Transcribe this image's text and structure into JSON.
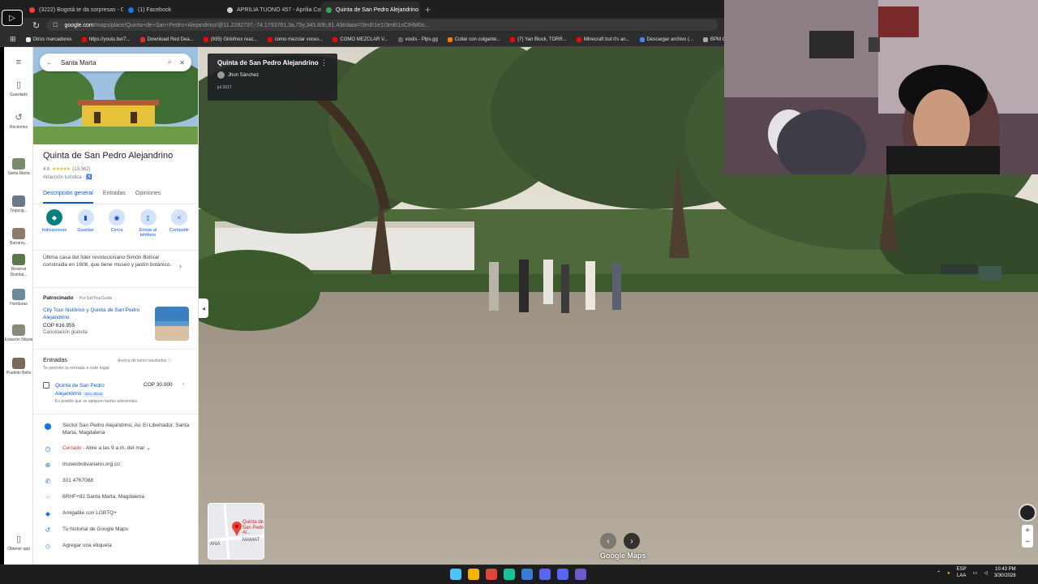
{
  "browser": {
    "tabs": [
      {
        "label": "(3222) Bogotá te da sorpresas - Obv...",
        "color": "#ff3b30",
        "active": false
      },
      {
        "label": "(1) Facebook",
        "color": "#1877f2",
        "active": false
      },
      {
        "label": "APRILIA TUONO 457 - Aprilia Colom...",
        "color": "#cfcfcf",
        "active": false
      },
      {
        "label": "Quinta de San Pedro Alejandrino",
        "color": "#34a853",
        "active": true
      }
    ],
    "url_domain": "google.com",
    "url_path": "/maps/place/Quinta+de+San+Pedro+Alejandrino/@11.2282737,-74.1793781,3a,75y,345.83h,81.43t/data=!3m8!1e1!3m6!1sCIHM0o...",
    "bookmarks": [
      {
        "label": "Otros marcadores",
        "color": "#e8eaed"
      },
      {
        "label": "https://youtu.be/7...",
        "color": "#ff0000"
      },
      {
        "label": "Download Red Dea...",
        "color": "#e52d27"
      },
      {
        "label": "(935) Girlofnox reac...",
        "color": "#ff0000"
      },
      {
        "label": "como mezclar voces...",
        "color": "#ff0000"
      },
      {
        "label": "COMO MEZCLAR V...",
        "color": "#ff0000"
      },
      {
        "label": "voxlis - Plps.gg",
        "color": "#666"
      },
      {
        "label": "Collar con colgante...",
        "color": "#f57c00"
      },
      {
        "label": "(7) Yan Block, TORR...",
        "color": "#ff0000"
      },
      {
        "label": "Minecraft but it's an...",
        "color": "#ff0000"
      },
      {
        "label": "Descargar archivo (...",
        "color": "#4285f4"
      },
      {
        "label": "BPM Cons",
        "color": "#aaa"
      }
    ]
  },
  "search": {
    "query": "Santa Marta"
  },
  "rail": {
    "saved": "Guardado",
    "recent": "Recientes",
    "places": [
      {
        "label": "Santa Marta",
        "color": "#7a8c6a"
      },
      {
        "label": "Tegucig...",
        "color": "#6a7a8c"
      },
      {
        "label": "Barranq...",
        "color": "#8c7a6a"
      },
      {
        "label": "Reserva Distrital...",
        "color": "#5a7a4a"
      },
      {
        "label": "Honduras",
        "color": "#6a8c9a"
      },
      {
        "label": "Estación Niquia",
        "color": "#8a8a7a"
      },
      {
        "label": "Pueblito Bello",
        "color": "#7a6a5a"
      }
    ],
    "get_app": "Obtener app"
  },
  "place": {
    "name": "Quinta de San Pedro Alejandrino",
    "rating": "4.6",
    "stars": "★★★★★",
    "reviews": "(13.562)",
    "category": "Atracción turística · ♿",
    "tabs": [
      "Descripción general",
      "Entradas",
      "Opiniones"
    ],
    "actions": [
      {
        "label": "Indicaciones",
        "icon": "◆"
      },
      {
        "label": "Guardar",
        "icon": "▮"
      },
      {
        "label": "Cerca",
        "icon": "◉"
      },
      {
        "label": "Enviar al teléfono",
        "icon": "▯"
      },
      {
        "label": "Compartir",
        "icon": "<"
      }
    ],
    "description": "Última casa del líder revolucionario Simón Bolívar construida en 1608, que tiene museo y jardín botánico.",
    "sponsored": {
      "label": "Patrocinado",
      "by": "· Por GetYourGuide ⋮",
      "title": "City Tour histórico y Quinta de San Pedro Alejandrino",
      "price": "COP 616.955",
      "cancel": "Cancelación gratuita"
    },
    "entries": {
      "title": "Entradas",
      "subtitle": "Te permite la entrada a este lugar",
      "about": "Acerca de estos resultados ⓘ",
      "ticket_name": "Quinta de San Pedro Alejandrino",
      "badge": "Sitio oficial",
      "ticket_price": "COP 30.000",
      "note": "Es posible que se apliquen tarifas adicionales"
    },
    "info": [
      {
        "icon": "⬤",
        "text": "Sector San Pedro Alejandrino, Av. El Libertador, Santa Marta, Magdalena",
        "red": ""
      },
      {
        "icon": "◷",
        "text": " · Abre a las 9 a.m. del mar ⌄",
        "red": "Cerrado"
      },
      {
        "icon": "⊕",
        "text": "museobolivariano.org.co",
        "red": ""
      },
      {
        "icon": "✆",
        "text": "301 4767088",
        "red": ""
      },
      {
        "icon": "⁘",
        "text": "6RHF+82 Santa Marta, Magdalena",
        "red": ""
      },
      {
        "icon": "◆",
        "text": "Amigable con LGBTQ+",
        "red": ""
      },
      {
        "icon": "↺",
        "text": "Tu historial de Google Maps",
        "red": ""
      },
      {
        "icon": "◇",
        "text": "Agregar una etiqueta",
        "red": ""
      }
    ]
  },
  "streetview": {
    "title": "Quinta de San Pedro Alejandrino",
    "author": "Jhon Sánchez",
    "date": "jul 2017",
    "minimap_label": "Quinta de San Pedro Al...",
    "minimap_street": "MAMAT",
    "minimap_side": "ANA",
    "logo": "Google Maps"
  },
  "taskbar": {
    "lang": "ESP",
    "lang2": "LAA",
    "time": "10:43 PM",
    "date": "3/30/2026",
    "apps": [
      "#4cc2ff",
      "#f4b400",
      "#e0443a",
      "#15c39a",
      "#3a7bd5",
      "#5865f2",
      "#5865f2",
      "#6a5acd"
    ]
  }
}
